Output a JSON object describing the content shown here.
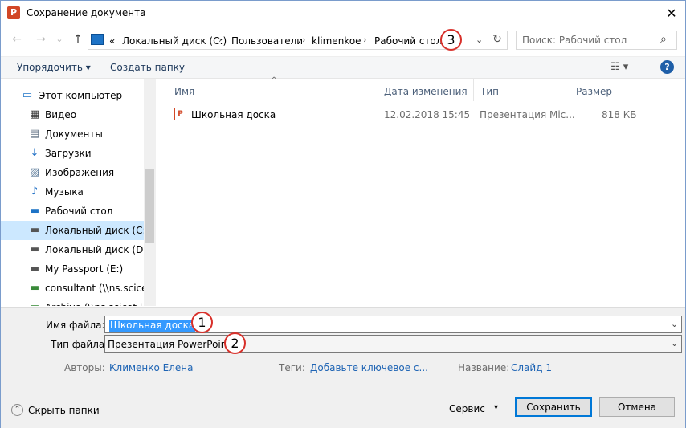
{
  "window": {
    "title": "Сохранение документа",
    "app_icon": "P",
    "close_glyph": "✕"
  },
  "nav": {
    "back": "←",
    "forward": "→",
    "dropdown": "⌄",
    "up": "↑"
  },
  "address": {
    "prefix": "«",
    "crumbs": [
      "Локальный диск (C:)",
      "Пользователи",
      "klimenkoe",
      "Рабочий стол"
    ],
    "separator": "›",
    "dropdown": "⌄",
    "refresh": "↻"
  },
  "search": {
    "placeholder": "Поиск: Рабочий стол",
    "icon": "⌕"
  },
  "toolbar": {
    "organize": "Упорядочить ▾",
    "new_folder": "Создать папку",
    "view_icon": "☷ ▾",
    "help": "?"
  },
  "nav_pane": {
    "items": [
      {
        "label": "Этот компьютер",
        "icon": "computer-icon",
        "glyph": "▭",
        "color": "#1d73c6"
      },
      {
        "label": "Видео",
        "icon": "video-icon",
        "glyph": "▦",
        "color": "#333333"
      },
      {
        "label": "Документы",
        "icon": "documents-icon",
        "glyph": "▤",
        "color": "#6b7a8b"
      },
      {
        "label": "Загрузки",
        "icon": "downloads-icon",
        "glyph": "↓",
        "color": "#1f6fc5"
      },
      {
        "label": "Изображения",
        "icon": "pictures-icon",
        "glyph": "▨",
        "color": "#5b7a99"
      },
      {
        "label": "Музыка",
        "icon": "music-icon",
        "glyph": "♪",
        "color": "#1f6fc5"
      },
      {
        "label": "Рабочий стол",
        "icon": "desktop-icon",
        "glyph": "▬",
        "color": "#1d73c6"
      },
      {
        "label": "Локальный диск (C:)",
        "icon": "drive-c-icon",
        "glyph": "▬",
        "color": "#555555"
      },
      {
        "label": "Локальный диск (D:)",
        "icon": "drive-d-icon",
        "glyph": "▬",
        "color": "#555555"
      },
      {
        "label": "My Passport (E:)",
        "icon": "drive-e-icon",
        "glyph": "▬",
        "color": "#555555"
      },
      {
        "label": "consultant (\\\\ns.scicet.",
        "icon": "network-drive-icon",
        "glyph": "▬",
        "color": "#3a8a3a"
      },
      {
        "label": "Archive (\\\\ns.scicet.l",
        "icon": "network-drive-icon",
        "glyph": "▬",
        "color": "#3a8a3a"
      }
    ],
    "selected_index": 7
  },
  "file_list": {
    "sort_glyph": "^",
    "headers": {
      "name": "Имя",
      "date": "Дата изменения",
      "type": "Тип",
      "size": "Размер"
    },
    "rows": [
      {
        "name": "Школьная доска",
        "date": "12.02.2018 15:45",
        "type": "Презентация Mic...",
        "size": "818 КБ",
        "icon": "P"
      }
    ]
  },
  "form": {
    "filename_label": "Имя файла:",
    "filename_value": "Школьная доска",
    "filetype_label": "Тип файла:",
    "filetype_value": "Презентация PowerPoint",
    "combo_arrow": "⌄",
    "authors_label": "Авторы:",
    "authors_value": "Клименко Елена",
    "tags_label": "Теги:",
    "tags_value": "Добавьте ключевое с...",
    "title_label": "Название:",
    "title_value": "Слайд 1"
  },
  "footer": {
    "hide_folders": "Скрыть папки",
    "hide_glyph": "⌃",
    "service": "Сервис",
    "service_arrow": "▾",
    "save": "Сохранить",
    "cancel": "Отмена"
  },
  "callouts": [
    "1",
    "2",
    "3"
  ],
  "colors": {
    "callout_border": "#d8302a",
    "selection": "#cce8ff",
    "link": "#1e64b4",
    "primary_border": "#0078d7"
  }
}
